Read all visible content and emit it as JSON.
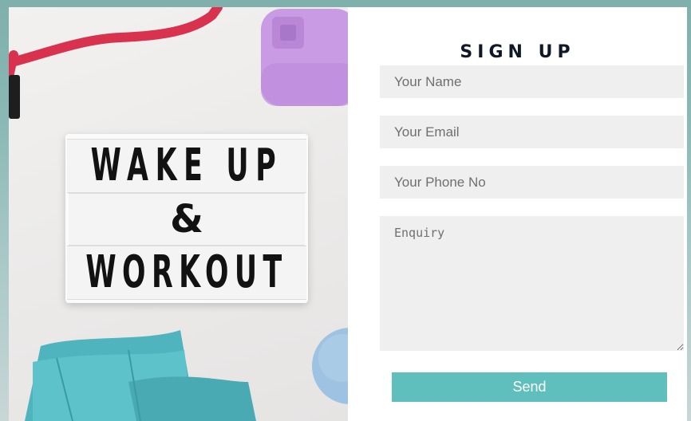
{
  "photo": {
    "sign_line1": "WAKE UP",
    "sign_line2": "&",
    "sign_line3": "WORKOUT"
  },
  "form": {
    "title": "SIGN UP",
    "name_placeholder": "Your Name",
    "email_placeholder": "Your Email",
    "phone_placeholder": "Your Phone No",
    "enquiry_placeholder": "Enquiry",
    "send_label": "Send"
  },
  "colors": {
    "accent": "#5fbfbc",
    "field_bg": "#efefef",
    "title": "#101828"
  }
}
